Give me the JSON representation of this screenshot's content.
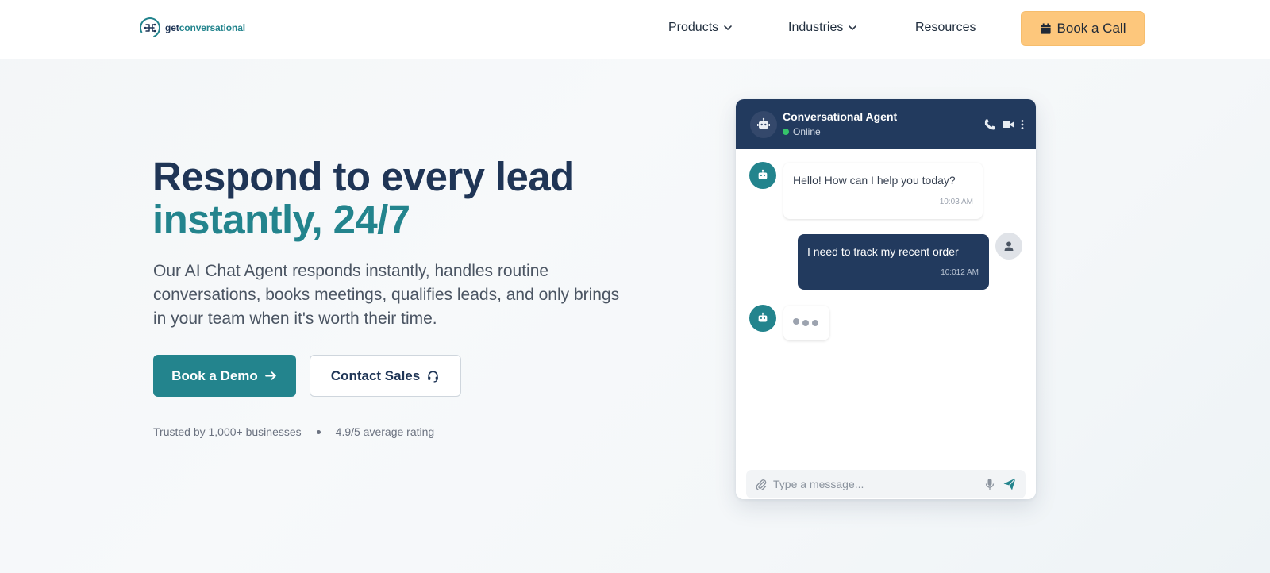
{
  "brand": {
    "name_part1": "get",
    "name_part2": "conversational"
  },
  "nav": {
    "items": [
      {
        "label": "Products",
        "has_dropdown": true
      },
      {
        "label": "Industries",
        "has_dropdown": true
      },
      {
        "label": "Resources",
        "has_dropdown": false
      }
    ],
    "cta_label": "Book a Call",
    "cta_icon": "calendar-icon"
  },
  "hero": {
    "headline_line1": "Respond to every lead",
    "headline_line2": "instantly, 24/7",
    "subtext": "Our AI Chat Agent responds instantly, handles routine conversations, books meetings, qualifies leads, and only brings in your team when it's worth their time.",
    "primary_button": "Book a Demo",
    "primary_icon": "arrow-right-icon",
    "secondary_button": "Contact Sales",
    "secondary_icon": "headset-icon",
    "trust_1": "Trusted by 1,000+ businesses",
    "trust_2": "4.9/5 average rating"
  },
  "chat": {
    "agent_name": "Conversational Agent",
    "status": "Online",
    "header_icons": [
      "phone-icon",
      "video-icon",
      "more-vertical-icon"
    ],
    "messages": [
      {
        "from": "bot",
        "text": "Hello! How can I help you today?",
        "time": "10:03 AM"
      },
      {
        "from": "user",
        "text": "I need to track my recent order",
        "time": "10:012 AM"
      }
    ],
    "typing_indicator": true,
    "input_placeholder": "Type a message...",
    "input_icons": [
      "paperclip-icon",
      "microphone-icon",
      "send-icon"
    ]
  },
  "colors": {
    "navy": "#1f3556",
    "teal": "#23848d",
    "cta_yellow": "#fdc77c",
    "chat_header": "#223a5e",
    "online_green": "#35c46a"
  }
}
